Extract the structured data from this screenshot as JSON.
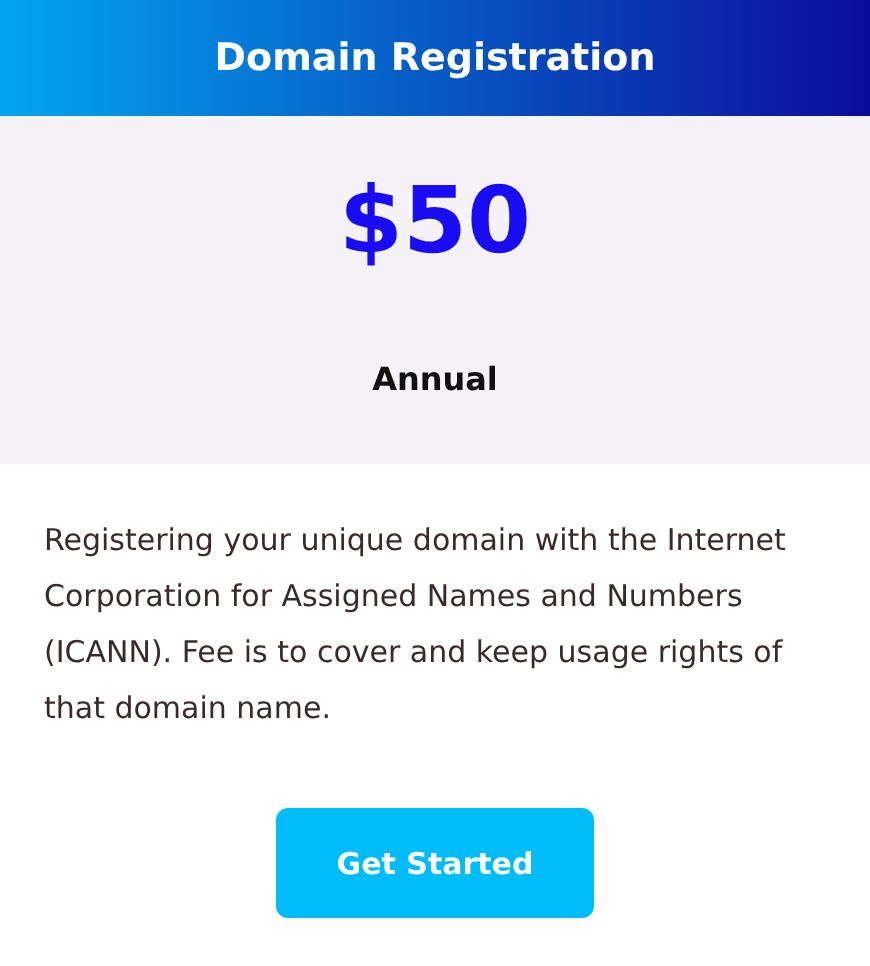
{
  "header": {
    "title": "Domain Registration"
  },
  "price": {
    "amount": "$50",
    "period": "Annual"
  },
  "description": "Registering your unique domain with the Internet Corporation for Assigned Names and Numbers (ICANN). Fee is to cover and keep usage rights of that domain name.",
  "button": {
    "label": "Get Started"
  }
}
